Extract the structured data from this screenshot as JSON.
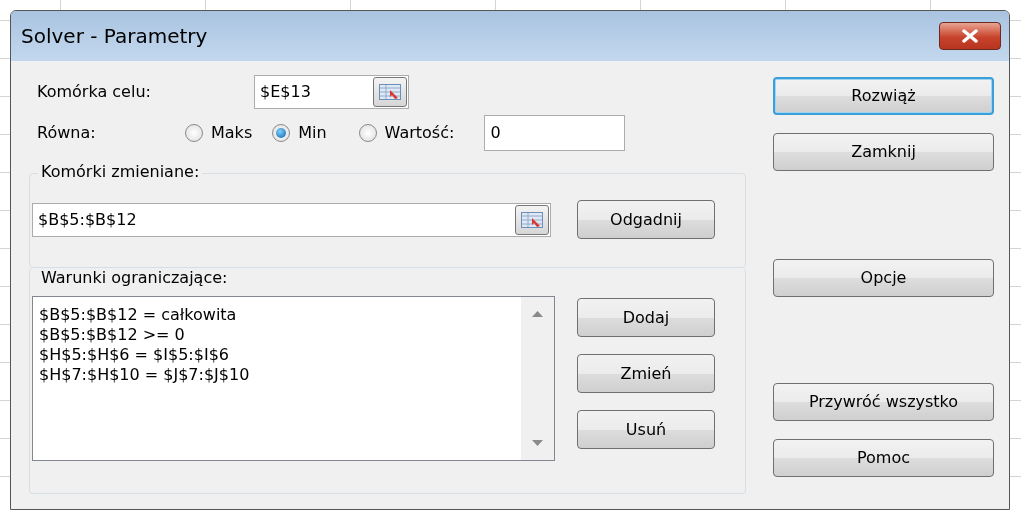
{
  "window": {
    "title": "Solver - Parametry"
  },
  "target_cell": {
    "label": "Komórka celu:",
    "value": "$E$13"
  },
  "equal_to": {
    "label": "Równa:",
    "options": [
      {
        "label": "Maks",
        "selected": false
      },
      {
        "label": "Min",
        "selected": true
      },
      {
        "label": "Wartość:",
        "selected": false
      }
    ],
    "value": "0"
  },
  "changing_cells": {
    "legend": "Komórki zmieniane:",
    "value": "$B$5:$B$12",
    "button": "Odgadnij"
  },
  "constraints": {
    "legend": "Warunki ograniczające:",
    "items": [
      "$B$5:$B$12 = całkowita",
      "$B$5:$B$12 >= 0",
      "$H$5:$H$6 = $I$5:$I$6",
      "$H$7:$H$10 = $J$7:$J$10"
    ],
    "buttons": [
      "Dodaj",
      "Zmień",
      "Usuń"
    ]
  },
  "buttons": [
    {
      "label": "Rozwiąż",
      "default": true
    },
    {
      "label": "Zamknij",
      "default": false
    },
    {
      "label": "Opcje",
      "default": false
    },
    {
      "label": "Przywróć wszystko",
      "default": false
    },
    {
      "label": "Pomoc",
      "default": false
    }
  ]
}
